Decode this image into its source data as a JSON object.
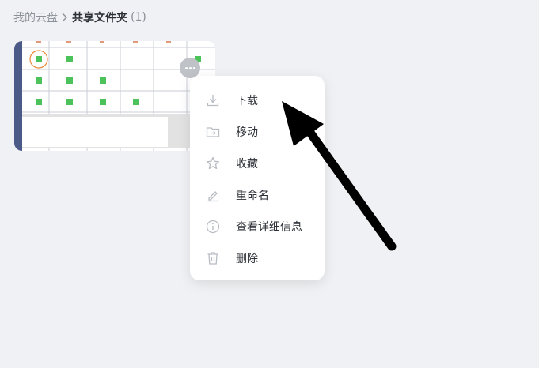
{
  "breadcrumb": {
    "root": "我的云盘",
    "current": "共享文件夹",
    "count": "(1)"
  },
  "context_menu": {
    "items": [
      {
        "label": "下载",
        "icon": "download-icon"
      },
      {
        "label": "移动",
        "icon": "move-folder-icon"
      },
      {
        "label": "收藏",
        "icon": "star-icon"
      },
      {
        "label": "重命名",
        "icon": "pencil-icon"
      },
      {
        "label": "查看详细信息",
        "icon": "info-icon"
      },
      {
        "label": "删除",
        "icon": "trash-icon"
      }
    ]
  },
  "colors": {
    "background": "#f0f1f4",
    "icon_gray": "#b8bcc3",
    "checkbox_green": "#4cc35a",
    "highlight_orange": "#e8873a",
    "card_edge": "#4b5a86",
    "arrow": "#000000"
  }
}
